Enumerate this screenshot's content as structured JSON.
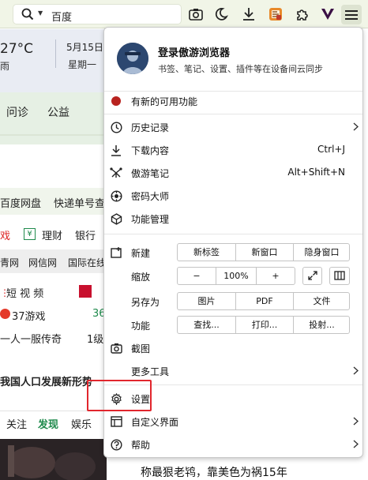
{
  "toolbar": {
    "search_value": "百度",
    "icons": [
      "search-icon",
      "screenshot-icon",
      "night-mode-icon",
      "download-icon",
      "extension-orange-icon",
      "puzzle-icon",
      "vivaldi-v-icon",
      "menu-icon"
    ]
  },
  "background": {
    "temperature": "27°C",
    "condition": "雨",
    "date": "5月15日",
    "weekday": "星期一",
    "nav1": "问诊",
    "nav2": "公益",
    "links1": [
      "百度网盘",
      "快递单号查"
    ],
    "links2": [
      "戏",
      "理财",
      "银行"
    ],
    "links3": [
      "青网",
      "网信网",
      "国际在线"
    ],
    "short_video": "短 视 频",
    "game": "37游戏",
    "game_num": "36",
    "legend": "一人一服传奇",
    "level": "1级",
    "news_title": "我国人口发展新形势",
    "tabs": [
      "关注",
      "发现",
      "娱乐"
    ],
    "caption": "称最狠老鸨，靠美色为祸15年"
  },
  "menu": {
    "account_title": "登录傲游浏览器",
    "account_sub": "书签、笔记、设置、插件等在设备间云同步",
    "update": "有新的可用功能",
    "history": "历史记录",
    "downloads": "下载内容",
    "downloads_shortcut": "Ctrl+J",
    "notes": "傲游笔记",
    "notes_shortcut": "Alt+Shift+N",
    "password": "密码大师",
    "features_mgmt": "功能管理",
    "new_label": "新建",
    "new_tab": "新标签",
    "new_window": "新窗口",
    "private_window": "隐身窗口",
    "zoom_label": "缩放",
    "zoom_minus": "−",
    "zoom_value": "100%",
    "zoom_plus": "+",
    "save_as_label": "另存为",
    "save_image": "图片",
    "save_pdf": "PDF",
    "save_file": "文件",
    "function_label": "功能",
    "find": "查找...",
    "print": "打印...",
    "cast": "投射...",
    "screenshot": "截图",
    "more_tools": "更多工具",
    "settings": "设置",
    "customize": "自定义界面",
    "help": "帮助"
  },
  "colors": {
    "highlight": "#e1262d",
    "accent_green": "#1f8a4c"
  }
}
